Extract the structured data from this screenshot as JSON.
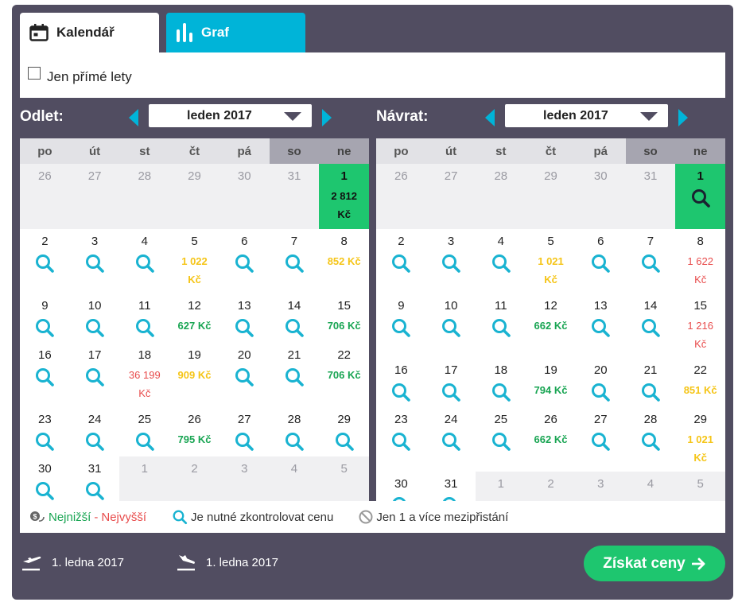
{
  "tabs": {
    "calendar": "Kalendář",
    "graph": "Graf"
  },
  "filter": {
    "direct_only": "Jen přímé lety"
  },
  "departure": {
    "title": "Odlet:",
    "month": "leden 2017",
    "weekdays": [
      "po",
      "út",
      "st",
      "čt",
      "pá",
      "so",
      "ne"
    ],
    "weeks": [
      [
        {
          "d": "26",
          "o": true
        },
        {
          "d": "27",
          "o": true
        },
        {
          "d": "28",
          "o": true
        },
        {
          "d": "29",
          "o": true
        },
        {
          "d": "30",
          "o": true
        },
        {
          "d": "31",
          "o": true
        },
        {
          "d": "1",
          "p": "2 812 Kč",
          "sel": true
        }
      ],
      [
        {
          "d": "2"
        },
        {
          "d": "3"
        },
        {
          "d": "4"
        },
        {
          "d": "5",
          "p": "1 022 Kč",
          "c": "yellow"
        },
        {
          "d": "6"
        },
        {
          "d": "7"
        },
        {
          "d": "8",
          "p": "852 Kč",
          "c": "yellow"
        }
      ],
      [
        {
          "d": "9"
        },
        {
          "d": "10"
        },
        {
          "d": "11"
        },
        {
          "d": "12",
          "p": "627 Kč",
          "c": "green"
        },
        {
          "d": "13"
        },
        {
          "d": "14"
        },
        {
          "d": "15",
          "p": "706 Kč",
          "c": "green"
        }
      ],
      [
        {
          "d": "16"
        },
        {
          "d": "17"
        },
        {
          "d": "18",
          "p": "36 199 Kč",
          "c": "red"
        },
        {
          "d": "19",
          "p": "909 Kč",
          "c": "yellow"
        },
        {
          "d": "20"
        },
        {
          "d": "21"
        },
        {
          "d": "22",
          "p": "706 Kč",
          "c": "green"
        }
      ],
      [
        {
          "d": "23"
        },
        {
          "d": "24"
        },
        {
          "d": "25"
        },
        {
          "d": "26",
          "p": "795 Kč",
          "c": "green"
        },
        {
          "d": "27"
        },
        {
          "d": "28"
        },
        {
          "d": "29"
        }
      ],
      [
        {
          "d": "30"
        },
        {
          "d": "31"
        },
        {
          "d": "1",
          "o": true
        },
        {
          "d": "2",
          "o": true
        },
        {
          "d": "3",
          "o": true
        },
        {
          "d": "4",
          "o": true
        },
        {
          "d": "5",
          "o": true
        }
      ]
    ]
  },
  "return": {
    "title": "Návrat:",
    "month": "leden 2017",
    "weekdays": [
      "po",
      "út",
      "st",
      "čt",
      "pá",
      "so",
      "ne"
    ],
    "weeks": [
      [
        {
          "d": "26",
          "o": true
        },
        {
          "d": "27",
          "o": true
        },
        {
          "d": "28",
          "o": true
        },
        {
          "d": "29",
          "o": true
        },
        {
          "d": "30",
          "o": true
        },
        {
          "d": "31",
          "o": true
        },
        {
          "d": "1",
          "sel": true
        }
      ],
      [
        {
          "d": "2"
        },
        {
          "d": "3"
        },
        {
          "d": "4"
        },
        {
          "d": "5",
          "p": "1 021 Kč",
          "c": "yellow"
        },
        {
          "d": "6"
        },
        {
          "d": "7"
        },
        {
          "d": "8",
          "p": "1 622 Kč",
          "c": "red"
        }
      ],
      [
        {
          "d": "9"
        },
        {
          "d": "10"
        },
        {
          "d": "11"
        },
        {
          "d": "12",
          "p": "662 Kč",
          "c": "green"
        },
        {
          "d": "13"
        },
        {
          "d": "14"
        },
        {
          "d": "15",
          "p": "1 216 Kč",
          "c": "red"
        }
      ],
      [
        {
          "d": "16"
        },
        {
          "d": "17"
        },
        {
          "d": "18"
        },
        {
          "d": "19",
          "p": "794 Kč",
          "c": "green"
        },
        {
          "d": "20"
        },
        {
          "d": "21"
        },
        {
          "d": "22",
          "p": "851 Kč",
          "c": "yellow"
        }
      ],
      [
        {
          "d": "23"
        },
        {
          "d": "24"
        },
        {
          "d": "25"
        },
        {
          "d": "26",
          "p": "662 Kč",
          "c": "green"
        },
        {
          "d": "27"
        },
        {
          "d": "28"
        },
        {
          "d": "29",
          "p": "1 021 Kč",
          "c": "yellow"
        }
      ],
      [
        {
          "d": "30"
        },
        {
          "d": "31"
        },
        {
          "d": "1",
          "o": true
        },
        {
          "d": "2",
          "o": true
        },
        {
          "d": "3",
          "o": true
        },
        {
          "d": "4",
          "o": true
        },
        {
          "d": "5",
          "o": true
        }
      ]
    ]
  },
  "legend": {
    "lowest": "Nejnižší",
    "separator": " - ",
    "highest": "Nejvyšší",
    "check_price": "Je nutné zkontrolovat cenu",
    "stopovers": "Jen 1 a více mezipřistání"
  },
  "summary": {
    "departure_date": "1. ledna 2017",
    "return_date": "1. ledna 2017"
  },
  "cta": {
    "label": "Získat ceny"
  },
  "colors": {
    "panel": "#514d61",
    "accent": "#00b4d8",
    "green": "#1ec66f",
    "price_green": "#19a553",
    "price_yellow": "#f5c518",
    "price_red": "#e84c4c"
  }
}
